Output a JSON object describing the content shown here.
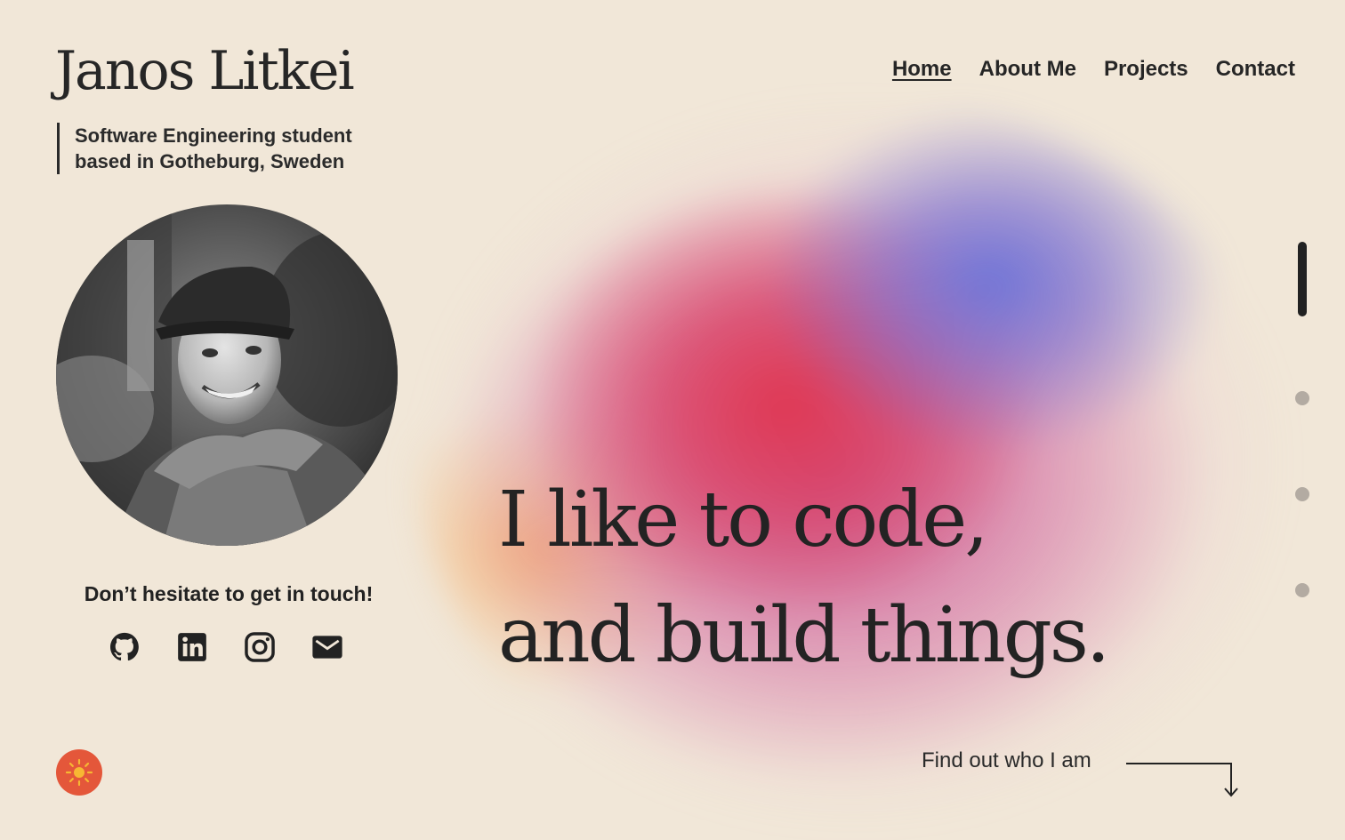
{
  "header": {
    "name": "Janos Litkei",
    "tagline_line1": "Software Engineering student",
    "tagline_line2": "based in Gotheburg, Sweden"
  },
  "nav": {
    "items": [
      {
        "label": "Home",
        "active": true
      },
      {
        "label": "About Me",
        "active": false
      },
      {
        "label": "Projects",
        "active": false
      },
      {
        "label": "Contact",
        "active": false
      }
    ]
  },
  "profile": {
    "photo_style": "grayscale portrait"
  },
  "contact": {
    "prompt": "Don’t hesitate to get in touch!",
    "socials": [
      {
        "icon": "github-icon"
      },
      {
        "icon": "linkedin-icon"
      },
      {
        "icon": "instagram-icon"
      },
      {
        "icon": "mail-icon"
      }
    ]
  },
  "hero": {
    "line1": "I like to code,",
    "line2": "and build things.",
    "cta_label": "Find out who I am"
  },
  "section_indicator": {
    "sections": 4,
    "active_index": 0
  },
  "theme_toggle": {
    "icon": "sun-icon",
    "color": "#e4573a"
  },
  "colors": {
    "background": "#f1e7d8",
    "text": "#232323",
    "gradient_red": "#e0344e",
    "gradient_blue": "#6870d8",
    "gradient_orange": "#f6b06e"
  }
}
